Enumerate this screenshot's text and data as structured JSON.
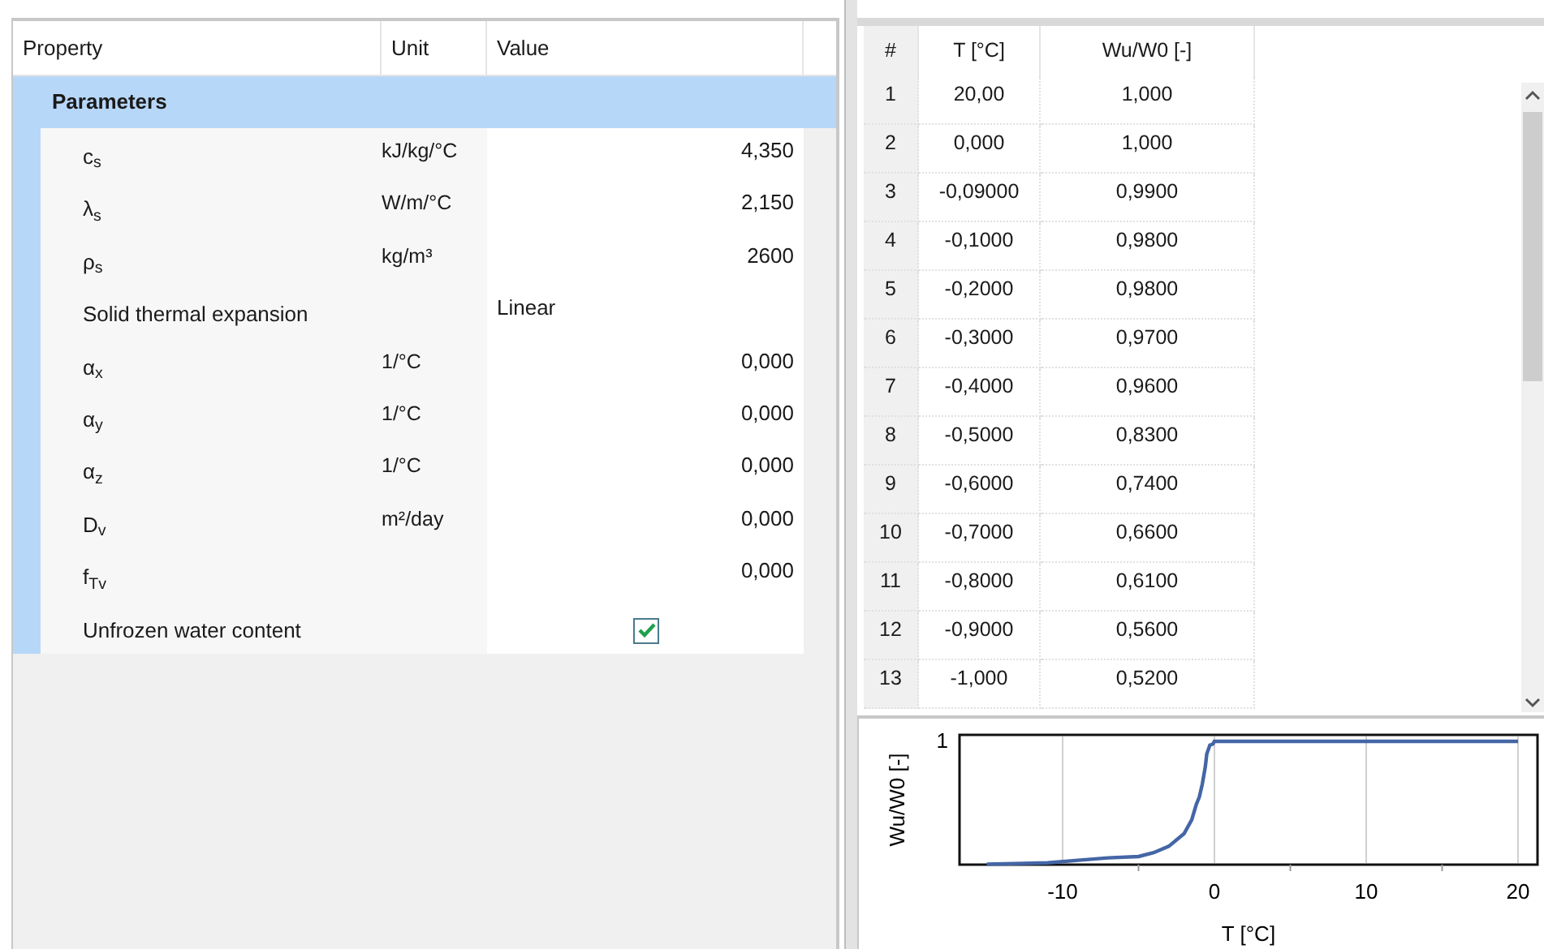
{
  "properties": {
    "columns": [
      "Property",
      "Unit",
      "Value"
    ],
    "group": {
      "label": "Parameters",
      "selected": true
    },
    "rows": [
      {
        "kind": "value",
        "name": "c$_{s}$",
        "unit": "kJ/kg/°C",
        "value": "4,350"
      },
      {
        "kind": "value",
        "name": "λ$_{s}$",
        "unit": "W/m/°C",
        "value": "2,150"
      },
      {
        "kind": "value",
        "name": "ρ$_{s}$",
        "unit": "kg/m³",
        "value": "2600"
      },
      {
        "kind": "text",
        "name": "Solid thermal expansion",
        "value": "Linear"
      },
      {
        "kind": "value",
        "name": "α$_{x}$",
        "unit": "1/°C",
        "value": "0,000"
      },
      {
        "kind": "value",
        "name": "α$_{y}$",
        "unit": "1/°C",
        "value": "0,000"
      },
      {
        "kind": "value",
        "name": "α$_{z}$",
        "unit": "1/°C",
        "value": "0,000"
      },
      {
        "kind": "value",
        "name": "D$_{v}$",
        "unit": "m²/day",
        "value": "0,000"
      },
      {
        "kind": "value",
        "name": "f$_{Tv}$",
        "value": "0,000"
      },
      {
        "kind": "checkbox",
        "name": "Unfrozen water content",
        "checked": true
      }
    ]
  },
  "curve_table": {
    "columns": [
      "#",
      "T [°C]",
      "Wu/W0 [-]"
    ],
    "rows": [
      [
        "1",
        "20,00",
        "1,000"
      ],
      [
        "2",
        "0,000",
        "1,000"
      ],
      [
        "3",
        "-0,09000",
        "0,9900"
      ],
      [
        "4",
        "-0,1000",
        "0,9800"
      ],
      [
        "5",
        "-0,2000",
        "0,9800"
      ],
      [
        "6",
        "-0,3000",
        "0,9700"
      ],
      [
        "7",
        "-0,4000",
        "0,9600"
      ],
      [
        "8",
        "-0,5000",
        "0,8300"
      ],
      [
        "9",
        "-0,6000",
        "0,7400"
      ],
      [
        "10",
        "-0,7000",
        "0,6600"
      ],
      [
        "11",
        "-0,8000",
        "0,6100"
      ],
      [
        "12",
        "-0,9000",
        "0,5600"
      ],
      [
        "13",
        "-1,000",
        "0,5200"
      ]
    ]
  },
  "plot": {
    "ylabel": "Wu/W0 [-]",
    "y_tick": "1",
    "x_ticks": [
      "-10",
      "0",
      "10",
      "20"
    ],
    "xlabel": "T [°C]"
  }
}
